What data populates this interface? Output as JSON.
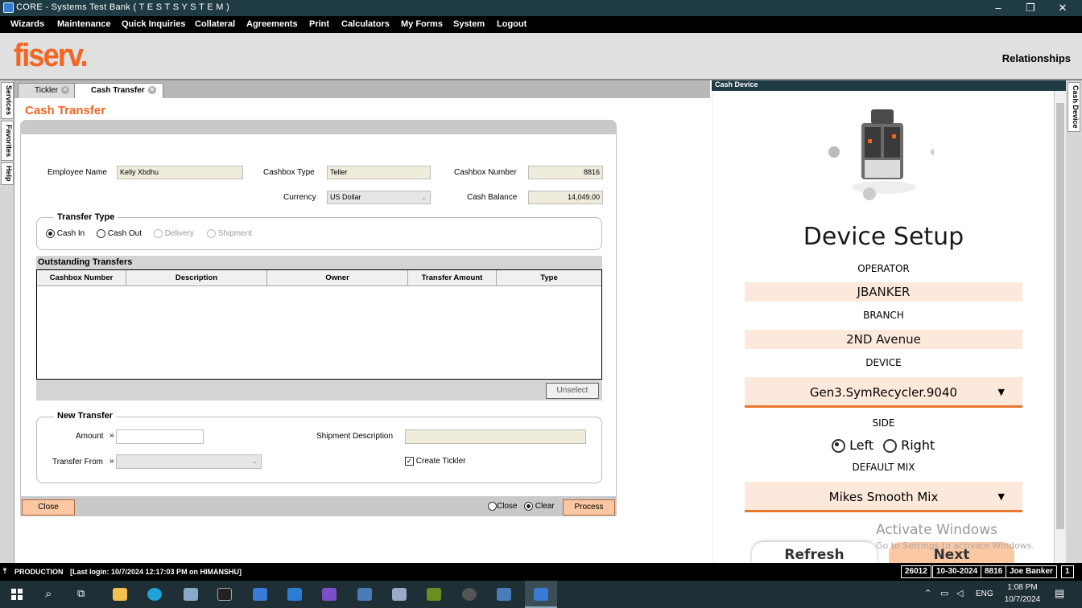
{
  "window": {
    "title": "CORE - Systems Test Bank ( T E S T   S Y S T E M )"
  },
  "menu": [
    "Wizards",
    "Maintenance",
    "Quick Inquiries",
    "Collateral",
    "Agreements",
    "Print",
    "Calculators",
    "My Forms",
    "System",
    "Logout"
  ],
  "header": {
    "logo": "fiserv.",
    "relationships": "Relationships"
  },
  "side_tabs": [
    "Services",
    "Favorites",
    "Help"
  ],
  "tabs": [
    {
      "label": "Tickler"
    },
    {
      "label": "Cash Transfer"
    }
  ],
  "page": {
    "title": "Cash Transfer"
  },
  "form": {
    "employee_name_label": "Employee Name",
    "employee_name": "Kelly Xbdhu",
    "cashbox_type_label": "Cashbox Type",
    "cashbox_type": "Teller",
    "cashbox_number_label": "Cashbox Number",
    "cashbox_number": "8816",
    "currency_label": "Currency",
    "currency": "US Dollar",
    "cash_balance_label": "Cash Balance",
    "cash_balance": "14,049.00"
  },
  "transfer_type": {
    "title": "Transfer Type",
    "options": [
      "Cash In",
      "Cash Out",
      "Delivery",
      "Shipment"
    ],
    "selected": "Cash In"
  },
  "outstanding": {
    "title": "Outstanding Transfers",
    "columns": [
      "Cashbox Number",
      "Description",
      "Owner",
      "Transfer Amount",
      "Type"
    ],
    "unselect": "Unselect"
  },
  "new_transfer": {
    "title": "New Transfer",
    "amount_label": "Amount",
    "amount": "",
    "shipment_label": "Shipment Description",
    "transfer_from_label": "Transfer From",
    "create_tickler": "Create Tickler",
    "arrow": "»"
  },
  "footer": {
    "close_btn": "Close",
    "close_radio": "Close",
    "clear_radio": "Clear",
    "process_btn": "Process"
  },
  "cash_device": {
    "panel_title": "Cash Device",
    "side_tab": "Cash Device",
    "heading": "Device Setup",
    "operator_label": "OPERATOR",
    "operator": "JBANKER",
    "branch_label": "BRANCH",
    "branch": "2ND Avenue",
    "device_label": "DEVICE",
    "device": "Gen3.SymRecycler.9040",
    "side_label": "SIDE",
    "side_left": "Left",
    "side_right": "Right",
    "side_selected": "Left",
    "mix_label": "DEFAULT MIX",
    "mix": "Mikes Smooth Mix",
    "refresh": "Refresh",
    "next": "Next"
  },
  "activate": {
    "line1": "Activate Windows",
    "line2": "Go to Settings to activate Windows."
  },
  "status": {
    "env": "PRODUCTION",
    "login": "[Last login: 10/7/2024 12:17:03 PM on HIMANSHU]",
    "boxes": [
      "26012",
      "10-30-2024",
      "8816",
      "Joe  Banker",
      "1"
    ]
  },
  "taskbar": {
    "lang": "ENG",
    "time": "1:08 PM",
    "date": "10/7/2024"
  }
}
